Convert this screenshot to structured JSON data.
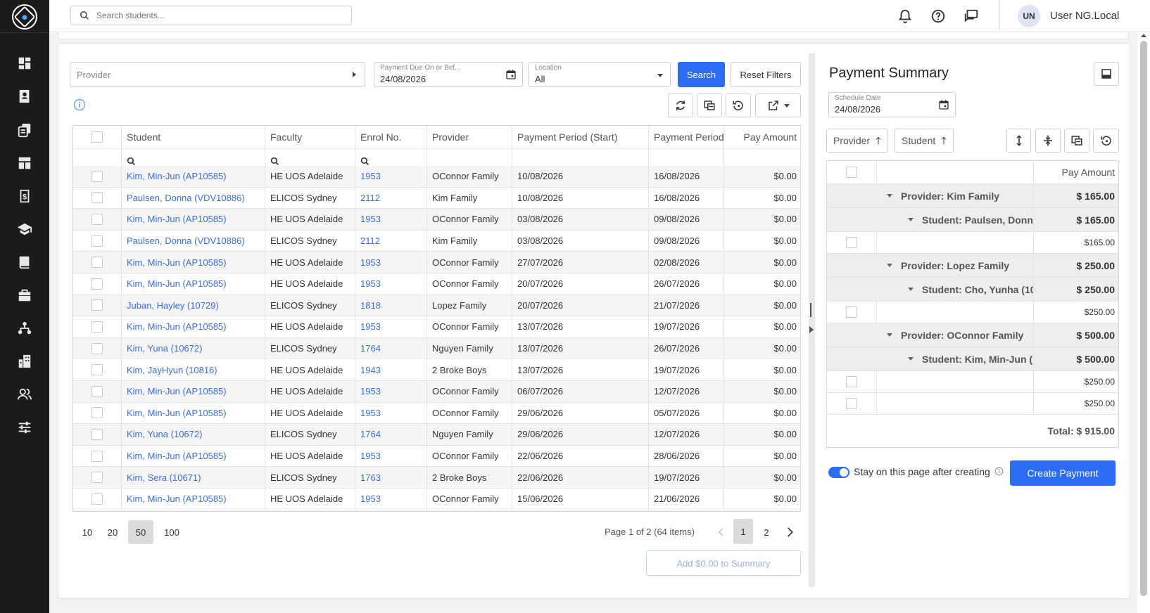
{
  "sidebar": {
    "icons": [
      "dashboard-icon",
      "student-card-icon",
      "copy-documents-icon",
      "layout-icon",
      "invoice-dollar-icon",
      "graduation-cap-icon",
      "book-icon",
      "briefcase-icon",
      "network-icon",
      "building-icon",
      "users-icon",
      "sliders-icon"
    ]
  },
  "topbar": {
    "search_placeholder": "Search students...",
    "avatar_initials": "UN",
    "username": "User NG.Local"
  },
  "filters": {
    "provider_placeholder": "Provider",
    "payment_due_label": "Payment Due On or Bef...",
    "payment_due_value": "24/08/2026",
    "location_label": "Location",
    "location_value": "All",
    "search_label": "Search",
    "reset_label": "Reset Filters"
  },
  "grid": {
    "columns": [
      "Student",
      "Faculty",
      "Enrol No.",
      "Provider",
      "Payment Period (Start)",
      "Payment Period",
      "Pay Amount"
    ],
    "rows": [
      {
        "student": "Kim, Min-Jun (AP10585)",
        "faculty": "HE UOS Adelaide",
        "enrol": "1953",
        "provider": "OConnor Family",
        "start": "10/08/2026",
        "end": "16/08/2026",
        "amount": "$0.00"
      },
      {
        "student": "Paulsen, Donna (VDV10886)",
        "faculty": "ELICOS Sydney",
        "enrol": "2112",
        "provider": "Kim Family",
        "start": "10/08/2026",
        "end": "16/08/2026",
        "amount": "$0.00"
      },
      {
        "student": "Kim, Min-Jun (AP10585)",
        "faculty": "HE UOS Adelaide",
        "enrol": "1953",
        "provider": "OConnor Family",
        "start": "03/08/2026",
        "end": "09/08/2026",
        "amount": "$0.00"
      },
      {
        "student": "Paulsen, Donna (VDV10886)",
        "faculty": "ELICOS Sydney",
        "enrol": "2112",
        "provider": "Kim Family",
        "start": "03/08/2026",
        "end": "09/08/2026",
        "amount": "$0.00"
      },
      {
        "student": "Kim, Min-Jun (AP10585)",
        "faculty": "HE UOS Adelaide",
        "enrol": "1953",
        "provider": "OConnor Family",
        "start": "27/07/2026",
        "end": "02/08/2026",
        "amount": "$0.00"
      },
      {
        "student": "Kim, Min-Jun (AP10585)",
        "faculty": "HE UOS Adelaide",
        "enrol": "1953",
        "provider": "OConnor Family",
        "start": "20/07/2026",
        "end": "26/07/2026",
        "amount": "$0.00"
      },
      {
        "student": "Juban, Hayley (10729)",
        "faculty": "ELICOS Sydney",
        "enrol": "1818",
        "provider": "Lopez Family",
        "start": "20/07/2026",
        "end": "21/07/2026",
        "amount": "$0.00"
      },
      {
        "student": "Kim, Min-Jun (AP10585)",
        "faculty": "HE UOS Adelaide",
        "enrol": "1953",
        "provider": "OConnor Family",
        "start": "13/07/2026",
        "end": "19/07/2026",
        "amount": "$0.00"
      },
      {
        "student": "Kim, Yuna (10672)",
        "faculty": "ELICOS Sydney",
        "enrol": "1764",
        "provider": "Nguyen Family",
        "start": "13/07/2026",
        "end": "26/07/2026",
        "amount": "$0.00"
      },
      {
        "student": "Kim, JayHyun (10816)",
        "faculty": "HE UOS Adelaide",
        "enrol": "1943",
        "provider": "2 Broke Boys",
        "start": "13/07/2026",
        "end": "19/07/2026",
        "amount": "$0.00"
      },
      {
        "student": "Kim, Min-Jun (AP10585)",
        "faculty": "HE UOS Adelaide",
        "enrol": "1953",
        "provider": "OConnor Family",
        "start": "06/07/2026",
        "end": "12/07/2026",
        "amount": "$0.00"
      },
      {
        "student": "Kim, Min-Jun (AP10585)",
        "faculty": "HE UOS Adelaide",
        "enrol": "1953",
        "provider": "OConnor Family",
        "start": "29/06/2026",
        "end": "05/07/2026",
        "amount": "$0.00"
      },
      {
        "student": "Kim, Yuna (10672)",
        "faculty": "ELICOS Sydney",
        "enrol": "1764",
        "provider": "Nguyen Family",
        "start": "29/06/2026",
        "end": "12/07/2026",
        "amount": "$0.00"
      },
      {
        "student": "Kim, Min-Jun (AP10585)",
        "faculty": "HE UOS Adelaide",
        "enrol": "1953",
        "provider": "OConnor Family",
        "start": "22/06/2026",
        "end": "28/06/2026",
        "amount": "$0.00"
      },
      {
        "student": "Kim, Sera (10671)",
        "faculty": "ELICOS Sydney",
        "enrol": "1763",
        "provider": "2 Broke Boys",
        "start": "22/06/2026",
        "end": "19/07/2026",
        "amount": "$0.00"
      },
      {
        "student": "Kim, Min-Jun (AP10585)",
        "faculty": "HE UOS Adelaide",
        "enrol": "1953",
        "provider": "OConnor Family",
        "start": "15/06/2026",
        "end": "21/06/2026",
        "amount": "$0.00"
      }
    ]
  },
  "pager": {
    "sizes": [
      "10",
      "20",
      "50",
      "100"
    ],
    "selected_size": "50",
    "info": "Page 1 of 2 (64 items)",
    "pages": [
      "1",
      "2"
    ],
    "current_page": "1"
  },
  "add_to_summary_label": "Add $0.00 to Summary",
  "summary": {
    "title": "Payment Summary",
    "schedule_label": "Schedule Date",
    "schedule_value": "24/08/2026",
    "group_chips": [
      "Provider",
      "Student"
    ],
    "column_header": "Pay Amount",
    "rows": [
      {
        "kind": "provider",
        "label": "Provider: Kim Family",
        "amount": "$ 165.00"
      },
      {
        "kind": "student",
        "label": "Student: Paulsen, Donna",
        "amount": "$ 165.00"
      },
      {
        "kind": "item",
        "label": "",
        "amount": "$165.00"
      },
      {
        "kind": "provider",
        "label": "Provider: Lopez Family",
        "amount": "$ 250.00"
      },
      {
        "kind": "student",
        "label": "Student: Cho, Yunha (10",
        "amount": "$ 250.00"
      },
      {
        "kind": "item",
        "label": "",
        "amount": "$250.00"
      },
      {
        "kind": "provider",
        "label": "Provider: OConnor Family",
        "amount": "$ 500.00"
      },
      {
        "kind": "student",
        "label": "Student: Kim, Min-Jun (",
        "amount": "$ 500.00"
      },
      {
        "kind": "item",
        "label": "",
        "amount": "$250.00"
      },
      {
        "kind": "item",
        "label": "",
        "amount": "$250.00"
      }
    ],
    "total": "Total: $ 915.00",
    "stay_label": "Stay on this page after creating",
    "stay_on": true,
    "create_label": "Create Payment"
  },
  "colors": {
    "accent": "#2d6cf5",
    "link": "#3a6fd8",
    "sidebar": "#1b1b1b"
  }
}
